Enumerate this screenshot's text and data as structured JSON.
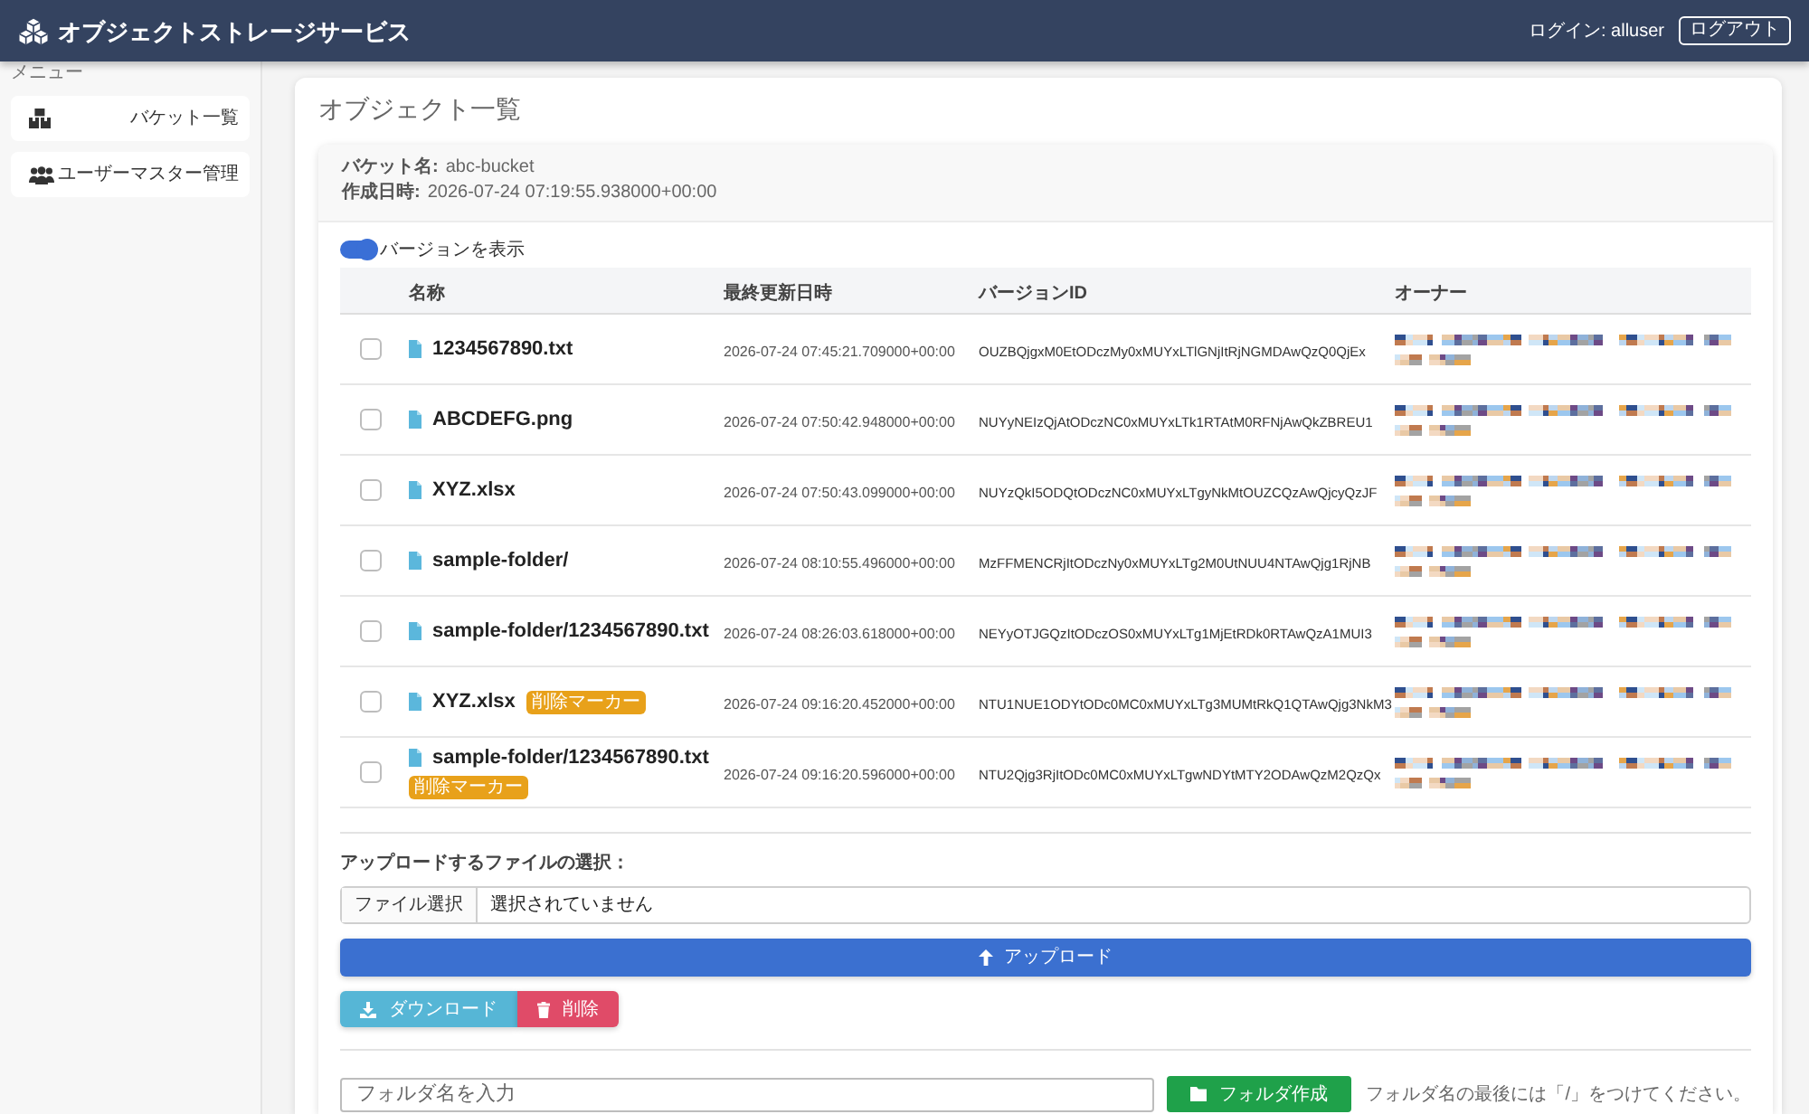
{
  "header": {
    "title": "オブジェクトストレージサービス",
    "login": "ログイン: alluser",
    "logout_button": "ログアウト"
  },
  "sidebar": {
    "heading": "メニュー",
    "items": [
      {
        "kind": "buckets",
        "label": "バケット一覧"
      },
      {
        "kind": "users",
        "label": "ユーザーマスター管理"
      }
    ]
  },
  "page_title": "オブジェクト一覧",
  "bucket_info": [
    {
      "label": "バケット名:",
      "value": "abc-bucket"
    },
    {
      "label": "作成日時:",
      "value": "2026-07-24 07:19:55.938000+00:00"
    }
  ],
  "version_toggle": {
    "label": "バージョンを表示",
    "on": true
  },
  "table": {
    "columns": [
      "名称",
      "最終更新日時",
      "バージョンID",
      "オーナー"
    ],
    "rows": [
      {
        "checked": false,
        "name": "1234567890.txt",
        "modified": "2026-07-24 07:45:21.709000+00:00",
        "version_id": "OUZBQjgxM0EtODczMy0xMUYxLTlGNjItRjNGMDAwQzQ0QjEx"
      },
      {
        "checked": false,
        "name": "ABCDEFG.png",
        "modified": "2026-07-24 07:50:42.948000+00:00",
        "version_id": "NUYyNEIzQjAtODczNC0xMUYxLTk1RTAtM0RFNjAwQkZBREU1"
      },
      {
        "checked": false,
        "name": "XYZ.xlsx",
        "modified": "2026-07-24 07:50:43.099000+00:00",
        "version_id": "NUYzQkI5ODQtODczNC0xMUYxLTgyNkMtOUZCQzAwQjcyQzJF"
      },
      {
        "checked": false,
        "name": "sample-folder/",
        "modified": "2026-07-24 08:10:55.496000+00:00",
        "version_id": "MzFFMENCRjItODczNy0xMUYxLTg2M0UtNUU4NTAwQjg1RjNB"
      },
      {
        "checked": false,
        "name": "sample-folder/1234567890.txt",
        "modified": "2026-07-24 08:26:03.618000+00:00",
        "version_id": "NEYyOTJGQzItODczOS0xMUYxLTg1MjEtRDk0RTAwQzA1MUI3"
      },
      {
        "checked": false,
        "name": "XYZ.xlsx",
        "badge": "削除マーカー",
        "modified": "2026-07-24 09:16:20.452000+00:00",
        "version_id": "NTU1NUE1ODYtODc0MC0xMUYxLTg3MUMtRkQ1QTAwQjg3NkM3"
      },
      {
        "checked": false,
        "name": "sample-folder/1234567890.txt",
        "badge": "削除マーカー",
        "modified": "2026-07-24 09:16:20.596000+00:00",
        "version_id": "NTU2Qjg3RjItODc0MC0xMUYxLTgwNDYtMTY2ODAwQzM2QzQx"
      }
    ]
  },
  "upload": {
    "label": "アップロードするファイルの選択：",
    "choose_button": "ファイル選択",
    "file_status": "選択されていません",
    "upload_button": "アップロード"
  },
  "actions": [
    {
      "kind": "download",
      "label": "ダウンロード"
    },
    {
      "kind": "delete",
      "label": "削除"
    }
  ],
  "new_folder": {
    "placeholder": "フォルダ名を入力",
    "button": "フォルダ作成",
    "hint": "フォルダ名の最後には「/」をつけてください。"
  }
}
